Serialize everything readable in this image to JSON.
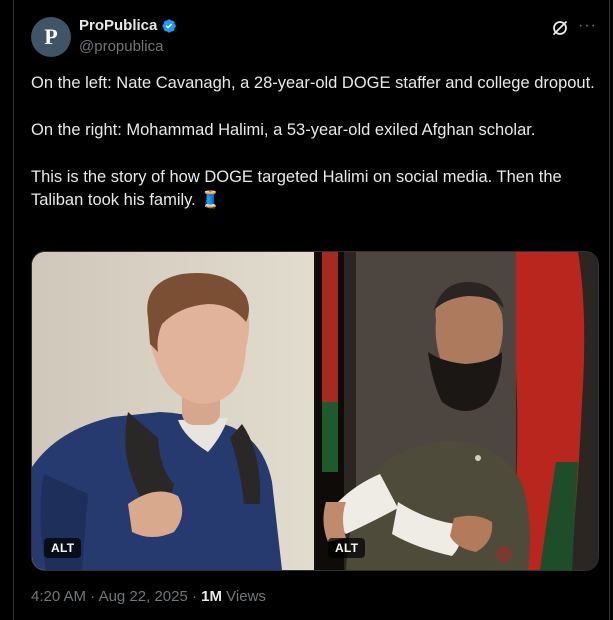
{
  "author": {
    "avatar_letter": "P",
    "display_name": "ProPublica",
    "handle": "@propublica",
    "verified_color": "#1d9bf0"
  },
  "actions": {
    "grok_icon": "grok-slash-icon",
    "more_label": "···"
  },
  "tweet": {
    "paragraphs": [
      "On the left: Nate Cavanagh, a 28-year-old DOGE staffer and college dropout.",
      "On the right: Mohammad Halimi, a 53-year-old exiled Afghan scholar.",
      "This is the story of how DOGE targeted Halimi on social media. Then the Taliban took his family. 🧵"
    ]
  },
  "media": {
    "images": [
      {
        "alt_badge": "ALT"
      },
      {
        "alt_badge": "ALT"
      }
    ]
  },
  "meta": {
    "time": "4:20 AM",
    "separator": " · ",
    "date": "Aug 22, 2025",
    "views_count": "1M",
    "views_label": " Views"
  },
  "colors": {
    "background": "#000000",
    "text": "#e7e9ea",
    "muted": "#71767b",
    "border": "#2f3336",
    "accent": "#1d9bf0"
  }
}
